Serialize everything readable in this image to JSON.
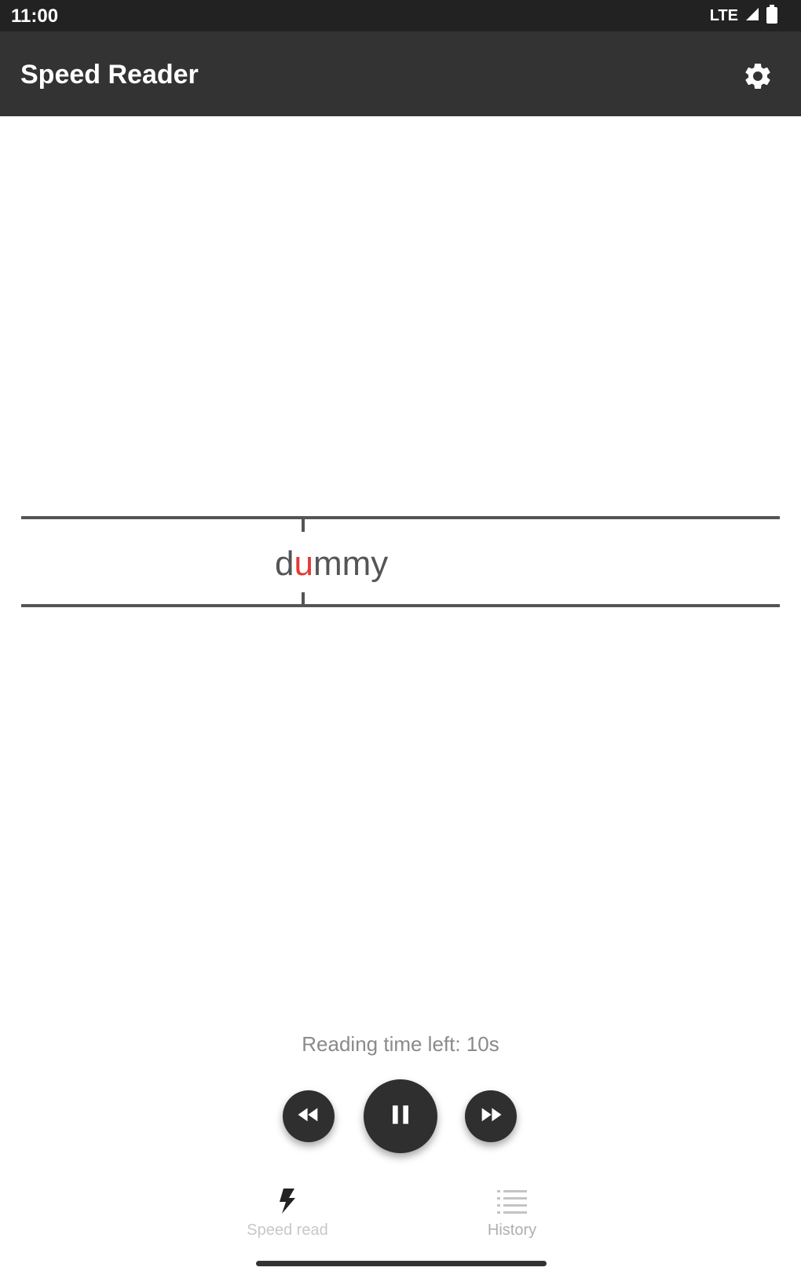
{
  "status_bar": {
    "time": "11:00",
    "network": "LTE"
  },
  "app_bar": {
    "title": "Speed Reader",
    "settings_icon": "gear-icon"
  },
  "reader": {
    "word_prefix": "d",
    "word_focus": "u",
    "word_suffix": "mmy",
    "focus_color": "#e53935"
  },
  "playback": {
    "time_left": "Reading time left: 10s",
    "rewind_icon": "rewind-icon",
    "pause_icon": "pause-icon",
    "forward_icon": "fast-forward-icon"
  },
  "bottom_nav": {
    "items": [
      {
        "label": "Speed read",
        "icon": "lightning-icon",
        "active": true
      },
      {
        "label": "History",
        "icon": "list-icon",
        "active": false
      }
    ]
  }
}
